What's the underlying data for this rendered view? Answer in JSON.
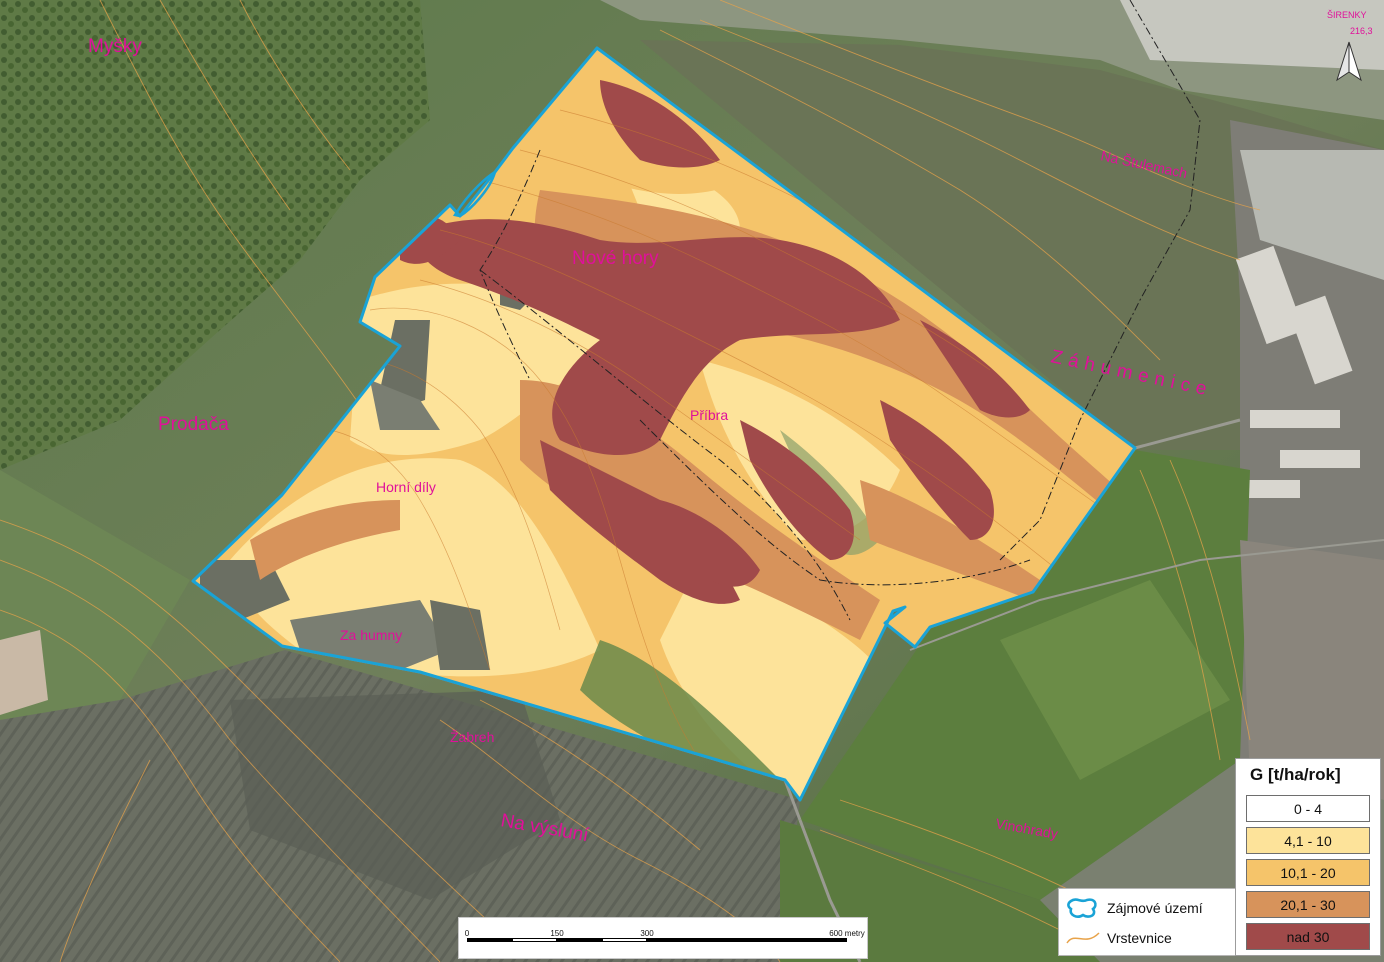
{
  "map": {
    "place_labels": {
      "mysky": "Myšky",
      "nove_hory": "Nové hory",
      "prodaca": "Prodača",
      "horni_dily": "Horní díly",
      "za_humny": "Za humny",
      "pribra": "Příbra",
      "zahumenice": "Záhumenice",
      "na_stulemach": "Na Štulemach",
      "zabreh": "Žabreh",
      "na_vysluni": "Na výsluní",
      "vinohrady": "Vinohrady",
      "sirenky": "ŠIRENKY",
      "sirenky_height": "216,3"
    }
  },
  "legend_g": {
    "title": "G [t/ha/rok]",
    "classes": [
      {
        "label": "0 - 4",
        "color": "#ffffff"
      },
      {
        "label": "4,1 - 10",
        "color": "#fde39a"
      },
      {
        "label": "10,1 - 20",
        "color": "#f5c46a"
      },
      {
        "label": "20,1 - 30",
        "color": "#d7935b"
      },
      {
        "label": "nad 30",
        "color": "#a04a4a"
      }
    ]
  },
  "legend_symbols": {
    "area_label": "Zájmové území",
    "contour_label": "Vrstevnice",
    "area_color": "#1aa3d6",
    "contour_color": "#e8a34a"
  },
  "scalebar": {
    "labels": [
      "0",
      "150",
      "300",
      "600 metry"
    ]
  },
  "north_arrow": {
    "icon": "north-arrow-icon"
  }
}
